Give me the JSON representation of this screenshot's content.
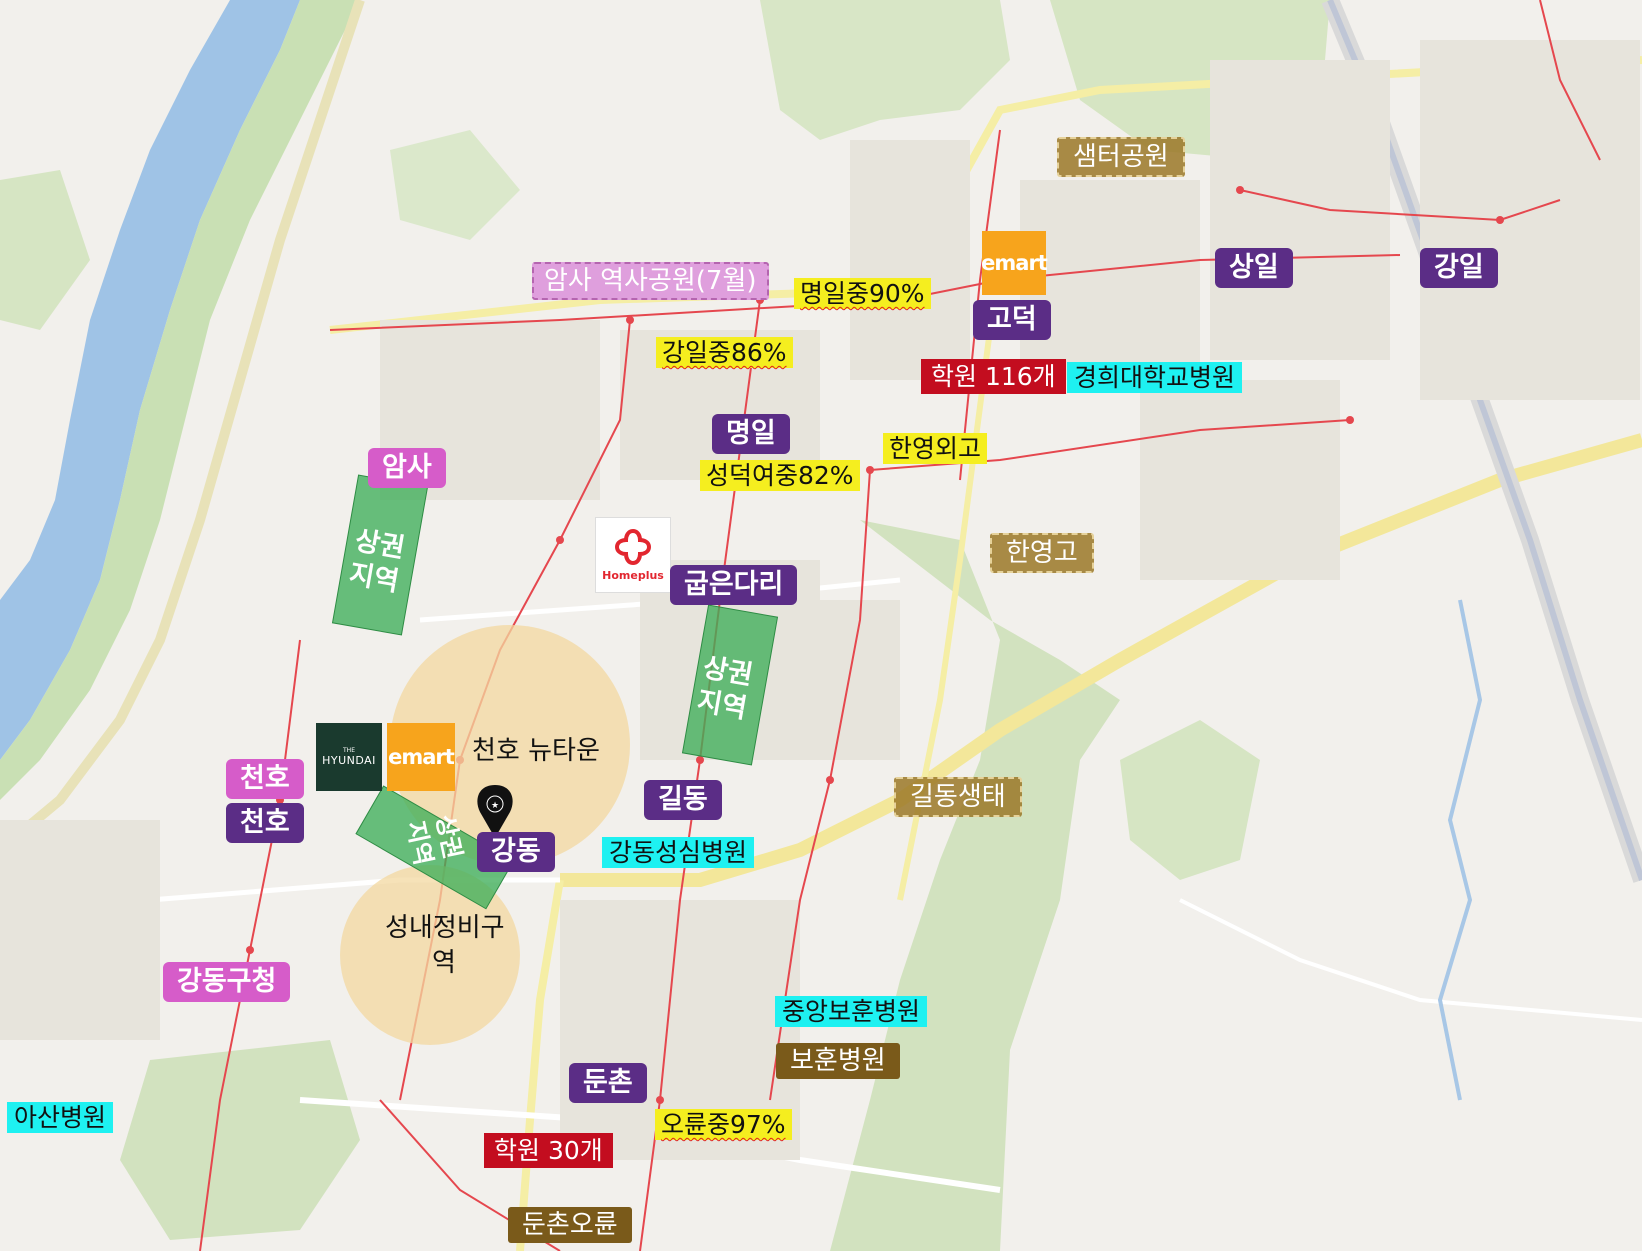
{
  "stations": [
    {
      "id": "samil",
      "label": "상일",
      "style": "st-purple"
    },
    {
      "id": "gangil",
      "label": "강일",
      "style": "st-purple"
    },
    {
      "id": "godeok",
      "label": "고덕",
      "style": "st-purple"
    },
    {
      "id": "myeongil",
      "label": "명일",
      "style": "st-purple"
    },
    {
      "id": "amsa",
      "label": "암사",
      "style": "st-pink"
    },
    {
      "id": "gubeundari",
      "label": "굽은다리",
      "style": "st-purple"
    },
    {
      "id": "cheonho-pink",
      "label": "천호",
      "style": "st-pink"
    },
    {
      "id": "cheonho-purple",
      "label": "천호",
      "style": "st-purple"
    },
    {
      "id": "gildong",
      "label": "길동",
      "style": "st-purple"
    },
    {
      "id": "gangdong",
      "label": "강동",
      "style": "st-purple"
    },
    {
      "id": "gangdong-gucheong",
      "label": "강동구청",
      "style": "st-pink"
    },
    {
      "id": "dunchon",
      "label": "둔촌",
      "style": "st-purple"
    }
  ],
  "schools": [
    {
      "id": "myeongil-middle",
      "label": "명일중90%"
    },
    {
      "id": "gangil-middle",
      "label": "강일중86%"
    },
    {
      "id": "hanyoung-foreign",
      "label": "한영외고"
    },
    {
      "id": "seongdeok-girls",
      "label": "성덕여중82%"
    },
    {
      "id": "oryun-middle",
      "label": "오륜중97%"
    }
  ],
  "hospitals": [
    {
      "id": "kyunghee",
      "label": "경희대학교병원"
    },
    {
      "id": "gangdong-seongsim",
      "label": "강동성심병원"
    },
    {
      "id": "jungang-bohun",
      "label": "중앙보훈병원"
    },
    {
      "id": "asan",
      "label": "아산병원"
    }
  ],
  "academies": [
    {
      "id": "academy-116",
      "label": "학원 116개"
    },
    {
      "id": "academy-30",
      "label": "학원 30개"
    }
  ],
  "parks": [
    {
      "id": "saemteo",
      "label": "샘터공원",
      "style": "park"
    },
    {
      "id": "amsa-historic",
      "label": "암사 역사공원(7월)",
      "style": "park-dashed-pink"
    },
    {
      "id": "hanyoung-high",
      "label": "한영고",
      "style": "park"
    },
    {
      "id": "gildong-eco",
      "label": "길동생태",
      "style": "park"
    },
    {
      "id": "bohun",
      "label": "보훈병원",
      "style": "park-solid"
    },
    {
      "id": "dunchon-oryun",
      "label": "둔촌오륜",
      "style": "park-solid"
    }
  ],
  "areas": {
    "cheonho_newtown": "천호 뉴타운",
    "seongnae_redevelopment_line1": "성내정비구",
    "seongnae_redevelopment_line2": "역"
  },
  "commercial_zones": [
    {
      "id": "zone-amsa",
      "line1": "상권",
      "line2": "지역"
    },
    {
      "id": "zone-gildong",
      "line1": "상권",
      "line2": "지역"
    },
    {
      "id": "zone-cheonho",
      "line1": "상권",
      "line2": "지역"
    }
  ],
  "brands": {
    "emart": "emart",
    "hyundai_small": "THE",
    "hyundai_big": "HYUNDAI",
    "homeplus": "Homeplus"
  },
  "colors": {
    "station_purple": "#5b2d86",
    "station_pink": "#d65cc9",
    "school_yellow": "#f5ee1f",
    "hospital_cyan": "#1ef1f1",
    "academy_red": "#c30d1f",
    "park_brown": "#9b7828",
    "commercial_green": "#3fae5a",
    "newtown_tan": "#f3d8a0",
    "river_blue": "#9fc3e6"
  }
}
